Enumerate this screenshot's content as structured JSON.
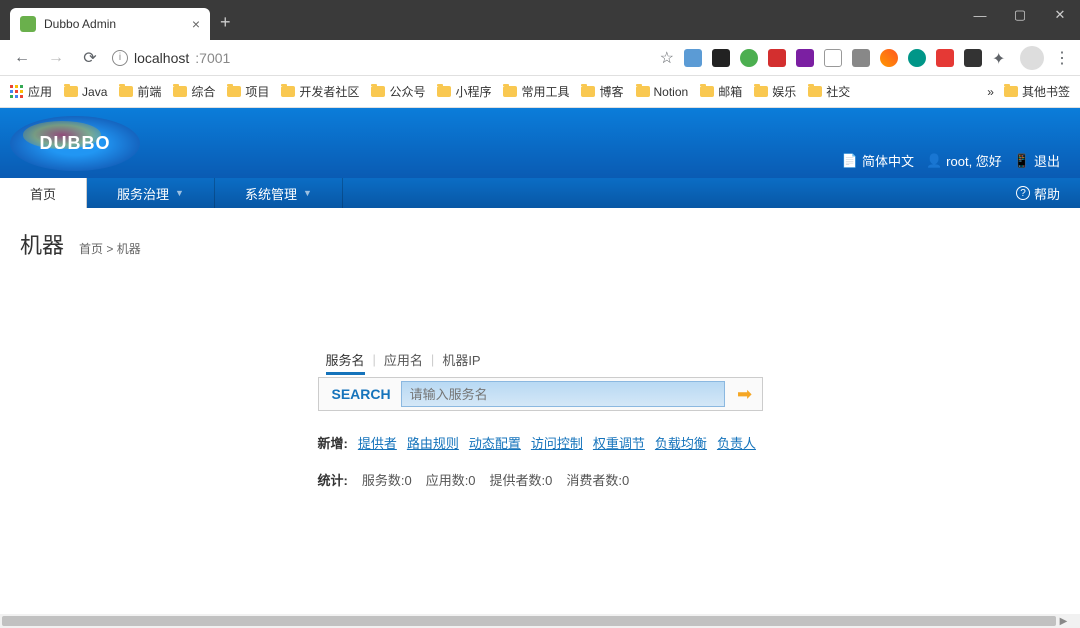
{
  "browser": {
    "tab_title": "Dubbo Admin",
    "url_host": "localhost",
    "url_port": ":7001",
    "bookmarks_apps": "应用",
    "bookmarks": [
      "Java",
      "前端",
      "综合",
      "项目",
      "开发者社区",
      "公众号",
      "小程序",
      "常用工具",
      "博客",
      "Notion",
      "邮箱",
      "娱乐",
      "社交"
    ],
    "bookmarks_more": "»",
    "bookmarks_other": "其他书签"
  },
  "header": {
    "logo_text": "DUBBO",
    "lang": "简体中文",
    "user_greeting": "root, 您好",
    "logout": "退出"
  },
  "nav": {
    "items": [
      {
        "label": "首页",
        "dropdown": false
      },
      {
        "label": "服务治理",
        "dropdown": true
      },
      {
        "label": "系统管理",
        "dropdown": true
      }
    ],
    "help": "帮助"
  },
  "page": {
    "title": "机器",
    "breadcrumb_home": "首页",
    "breadcrumb_sep": " > ",
    "breadcrumb_current": "机器"
  },
  "search": {
    "tabs": [
      "服务名",
      "应用名",
      "机器IP"
    ],
    "label": "SEARCH",
    "placeholder": "请输入服务名"
  },
  "addnew": {
    "label": "新增:",
    "links": [
      "提供者",
      "路由规则",
      "动态配置",
      "访问控制",
      "权重调节",
      "负载均衡",
      "负责人"
    ]
  },
  "stats": {
    "label": "统计:",
    "items": [
      "服务数:0",
      "应用数:0",
      "提供者数:0",
      "消费者数:0"
    ]
  },
  "colors": {
    "ext": [
      "#5b9bd5",
      "#222",
      "#4caf50",
      "#d32f2f",
      "#7b1fa2",
      "#666",
      "#555",
      "#ff9800",
      "#009688",
      "#e53935",
      "#333",
      "#444"
    ]
  }
}
